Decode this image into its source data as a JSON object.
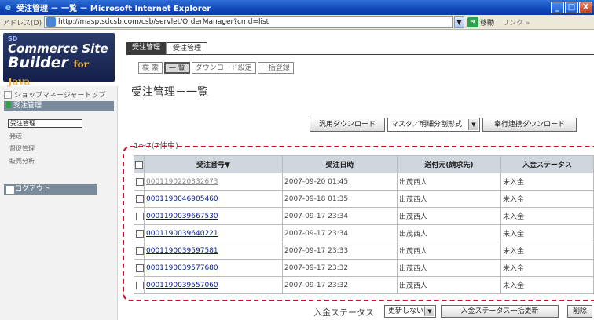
{
  "window": {
    "title": "受注管理 － 一覧 － Microsoft Internet Explorer",
    "buttons": [
      "_",
      "□",
      "X"
    ]
  },
  "addressbar": {
    "label": "アドレス(D)",
    "url": "http://masp.sdcsb.com/csb/servlet/OrderManager?cmd=list",
    "go_label": "移動",
    "links_label": "リンク »"
  },
  "logo": {
    "sd": "SD",
    "line1": "Commerce Site",
    "line2": "Builder",
    "line2_suffix": "for Java"
  },
  "sidebar": {
    "top_link": "ショップマネージャートップ",
    "section": "受注管理",
    "items": [
      {
        "label": "受注管理",
        "active": true
      },
      {
        "label": "発送",
        "active": false
      },
      {
        "label": "督促管理",
        "active": false
      },
      {
        "label": "販売分析",
        "active": false
      }
    ],
    "logout": "ログアウト"
  },
  "tabs": [
    "受注管理",
    "受注管理"
  ],
  "subbuttons": [
    "検 索",
    "一 覧",
    "ダウンロード設定",
    "一括登録"
  ],
  "page_title": "受注管理－一覧",
  "download": {
    "general_download": "汎用ダウンロード",
    "format_select": "マスタ／明細分割形式",
    "bugyo_download": "奉行連携ダウンロード"
  },
  "count_text": "1～7(7件中)",
  "table": {
    "headers": [
      "受注番号▼",
      "受注日時",
      "送付元(請求先)",
      "入金ステータス"
    ],
    "rows": [
      {
        "order_no": "0001190220332673",
        "date": "2007-09-20 01:45",
        "sender": "出茂西人",
        "status": "未入金",
        "visited": true
      },
      {
        "order_no": "0001190046905460",
        "date": "2007-09-18 01:35",
        "sender": "出茂西人",
        "status": "未入金",
        "visited": false
      },
      {
        "order_no": "0001190039667530",
        "date": "2007-09-17 23:34",
        "sender": "出茂西人",
        "status": "未入金",
        "visited": false
      },
      {
        "order_no": "0001190039640221",
        "date": "2007-09-17 23:34",
        "sender": "出茂西人",
        "status": "未入金",
        "visited": false
      },
      {
        "order_no": "0001190039597581",
        "date": "2007-09-17 23:33",
        "sender": "出茂西人",
        "status": "未入金",
        "visited": false
      },
      {
        "order_no": "0001190039577680",
        "date": "2007-09-17 23:32",
        "sender": "出茂西人",
        "status": "未入金",
        "visited": false
      },
      {
        "order_no": "0001190039557060",
        "date": "2007-09-17 23:32",
        "sender": "出茂西人",
        "status": "未入金",
        "visited": false
      }
    ]
  },
  "bottom": {
    "label": "入金ステータス",
    "select": "更新しない",
    "bulk_update": "入金ステータス一括更新",
    "delete": "削除"
  },
  "colors": {
    "highlight": "#c8102e",
    "titlebar": "#1048b8"
  }
}
